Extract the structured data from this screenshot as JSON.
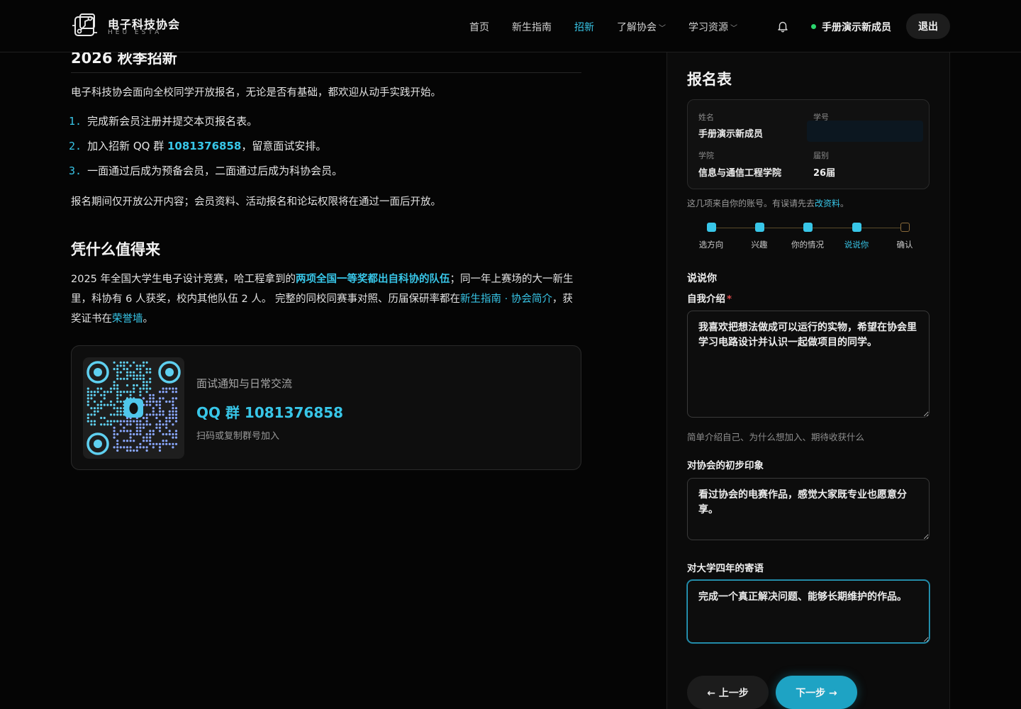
{
  "nav": {
    "brand_title": "电子科技协会",
    "brand_sub": "HEU ESTA",
    "items": [
      {
        "label": "首页"
      },
      {
        "label": "新生指南"
      },
      {
        "label": "招新"
      },
      {
        "label": "了解协会"
      },
      {
        "label": "学习资源"
      }
    ],
    "active_item": "招新",
    "user_name": "手册演示新成员",
    "logout_label": "退出"
  },
  "main": {
    "section_title": "2026 秋季招新",
    "intro": "电子科技协会面向全校同学开放报名，无论是否有基础，都欢迎从动手实践开始。",
    "steps": [
      {
        "num": "1.",
        "text": "完成新会员注册并提交本页报名表。"
      },
      {
        "num": "2.",
        "text_before": "加入招新 QQ 群 ",
        "qq": "1081376858",
        "text_after": "，留意面试安排。"
      },
      {
        "num": "3.",
        "text": "一面通过后成为预备会员，二面通过后成为科协会员。"
      }
    ],
    "notice": "报名期间仅开放公开内容；会员资料、活动报名和论坛权限将在通过一面后开放。",
    "why_title": "凭什么值得来",
    "why_p1_a": "2025 年全国大学生电子设计竞赛，哈工程拿到的",
    "why_p1_hl": "两项全国一等奖都出自科协的队伍",
    "why_p1_b": "；同一年上赛场的大一新生里，科协有 6 人获奖，校内其他队伍 2 人。 完整的同校同赛事对照、历届保研率都在",
    "why_link1": "新生指南 · 协会简介",
    "why_p1_c": "，获奖证书在",
    "why_link2": "荣誉墙",
    "why_p1_d": "。",
    "qq_card": {
      "line1": "面试通知与日常交流",
      "line2": "QQ 群 1081376858",
      "line3": "扫码或复制群号加入"
    }
  },
  "form": {
    "title": "报名表",
    "info": {
      "name_label": "姓名",
      "name_value": "手册演示新成员",
      "id_label": "学号",
      "id_value": "",
      "college_label": "学院",
      "college_value": "信息与通信工程学院",
      "year_label": "届别",
      "year_value": "26届"
    },
    "hint_prefix": "这几项来自你的账号。有误请先去",
    "hint_link": "改资料",
    "hint_suffix": "。",
    "steps": [
      {
        "label": "选方向",
        "state": "done"
      },
      {
        "label": "兴趣",
        "state": "done"
      },
      {
        "label": "你的情况",
        "state": "done"
      },
      {
        "label": "说说你",
        "state": "current"
      },
      {
        "label": "确认",
        "state": "todo"
      }
    ],
    "section": "说说你",
    "intro_label": "自我介绍",
    "intro_required": "*",
    "intro_value": "我喜欢把想法做成可以运行的实物，希望在协会里学习电路设计并认识一起做项目的同学。",
    "intro_hint": "简单介绍自己、为什么想加入、期待收获什么",
    "impression_label": "对协会的初步印象",
    "impression_value": "看过协会的电赛作品，感觉大家既专业也愿意分享。",
    "wish_label": "对大学四年的寄语",
    "wish_value": "完成一个真正解决问题、能够长期维护的作品。",
    "prev_label": "← 上一步",
    "next_label": "下一步 →"
  },
  "colors": {
    "accent": "#38c6e8",
    "online": "#2bd66e",
    "background": "#050505"
  }
}
